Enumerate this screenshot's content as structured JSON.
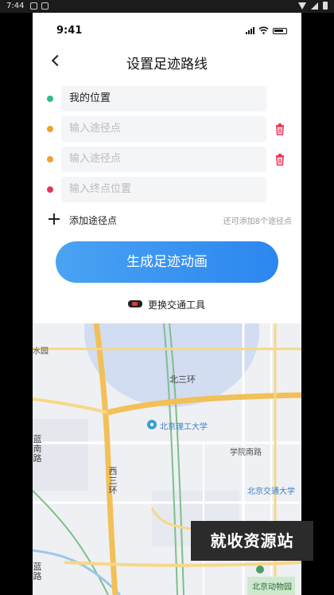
{
  "android_status": {
    "time": "7:44"
  },
  "ios_status": {
    "time": "9:41"
  },
  "header": {
    "title": "设置足迹路线"
  },
  "route": {
    "start": {
      "value": "我的位置",
      "dot_color": "#2bbf83"
    },
    "waypoints": [
      {
        "placeholder": "输入途径点",
        "dot_color": "#f0a030"
      },
      {
        "placeholder": "输入途径点",
        "dot_color": "#f0a030"
      }
    ],
    "end": {
      "placeholder": "输入终点位置",
      "dot_color": "#e8365a"
    }
  },
  "add_waypoint": {
    "label": "添加途径点",
    "hint": "还可添加8个途径点"
  },
  "generate_button": {
    "label": "生成足迹动画"
  },
  "transport": {
    "label": "更换交通工具"
  },
  "map": {
    "labels": {
      "north_third_ring": "北三环",
      "bit": "北京理工大学",
      "xueyuan_south": "学院南路",
      "bjtu": "北京交通大学",
      "zoo": "北京动物园",
      "garden": "水园",
      "west_third_ring": "西三环",
      "left_vertical": "蓝南路",
      "left_vertical2": "蓝路"
    }
  },
  "watermark": "就收资源站"
}
